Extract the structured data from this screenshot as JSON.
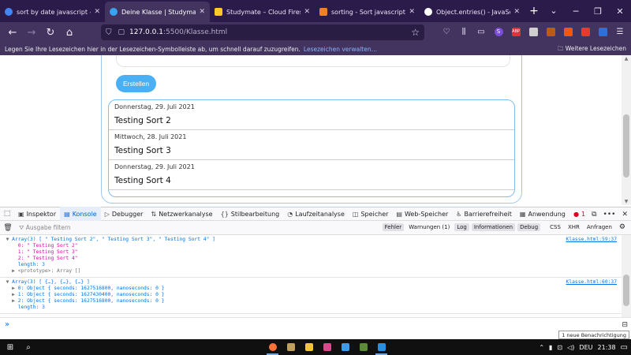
{
  "browser": {
    "tabs": [
      {
        "title": "sort by date javascript - Goog",
        "favicon_color": "#4285f4"
      },
      {
        "title": "Deine Klasse | Studymate.ch",
        "favicon_color": "#3aa3f0"
      },
      {
        "title": "Studymate – Cloud Firestore",
        "favicon_color": "#ffca28"
      },
      {
        "title": "sorting - Sort javascript objec",
        "favicon_color": "#f48024"
      },
      {
        "title": "Object.entries() - JavaScript |",
        "favicon_color": "#ffffff"
      }
    ],
    "url_host": "127.0.0.1",
    "url_path": ":5500/Klasse.html",
    "bookmarks_text": "Legen Sie Ihre Lesezeichen hier in der Lesezeichen-Symbolleiste ab, um schnell darauf zuzugreifen.",
    "bookmarks_link": "Lesezeichen verwalten…",
    "other_bookmarks": "Weitere Lesezeichen",
    "extensions": [
      {
        "label": "S",
        "color": "#7b4dd8"
      },
      {
        "label": "ABP",
        "color": "#e0323c"
      },
      {
        "label": "",
        "color": "#cfcfcf"
      },
      {
        "label": "",
        "color": "#b75e14"
      },
      {
        "label": "",
        "color": "#e85a1a"
      },
      {
        "label": "",
        "color": "#e63b2e"
      },
      {
        "label": "",
        "color": "#2f6fd6"
      }
    ]
  },
  "page": {
    "create_button": "Erstellen",
    "items": [
      {
        "date": "Donnerstag, 29. Juli 2021",
        "title": "Testing Sort 2"
      },
      {
        "date": "Mittwoch, 28. Juli 2021",
        "title": "Testing Sort 3"
      },
      {
        "date": "Donnerstag, 29. Juli 2021",
        "title": "Testing Sort 4"
      }
    ]
  },
  "devtools": {
    "tabs": [
      "Inspektor",
      "Konsole",
      "Debugger",
      "Netzwerkanalyse",
      "Stilbearbeitung",
      "Laufzeitanalyse",
      "Speicher",
      "Web-Speicher",
      "Barrierefreiheit",
      "Anwendung"
    ],
    "error_count": "1",
    "filter_placeholder": "Ausgabe filtern",
    "filter_buttons": [
      "Fehler",
      "Warnungen (1)",
      "Log",
      "Informationen",
      "Debug"
    ],
    "filter_extra": [
      "CSS",
      "XHR",
      "Anfragen"
    ],
    "log1": {
      "header": "Array(3) [ \" Testing Sort 2\", \" Testing Sort 3\", \" Testing Sort 4\" ]",
      "source": "Klasse.html:59:37",
      "rows": [
        "0: \" Testing Sort 2\"",
        "1: \" Testing Sort 3\"",
        "2: \" Testing Sort 4\""
      ],
      "length": "length: 3",
      "proto": "<prototype>: Array []"
    },
    "log2": {
      "header": "Array(3) [ {…}, {…}, {…} ]",
      "source": "Klasse.html:60:37",
      "rows": [
        "0: Object { seconds: 1627516800, nanoseconds: 0 }",
        "1: Object { seconds: 1627430400, nanoseconds: 0 }",
        "2: Object { seconds: 1627516800, nanoseconds: 0 }"
      ],
      "length": "length: 3"
    },
    "notification": "1 neue Benachrichtigung"
  },
  "taskbar": {
    "apps": [
      {
        "name": "firefox",
        "color": "#ff7139",
        "open": true
      },
      {
        "name": "app2",
        "color": "#c0a060",
        "open": false
      },
      {
        "name": "app3",
        "color": "#f3c33b",
        "open": false
      },
      {
        "name": "app4",
        "color": "#d64a8c",
        "open": false
      },
      {
        "name": "app5",
        "color": "#3d9be9",
        "open": false
      },
      {
        "name": "app6",
        "color": "#5c8c3a",
        "open": false
      },
      {
        "name": "vscode",
        "color": "#2a8fe0",
        "open": true
      }
    ],
    "lang": "DEU",
    "time": "21:38"
  }
}
